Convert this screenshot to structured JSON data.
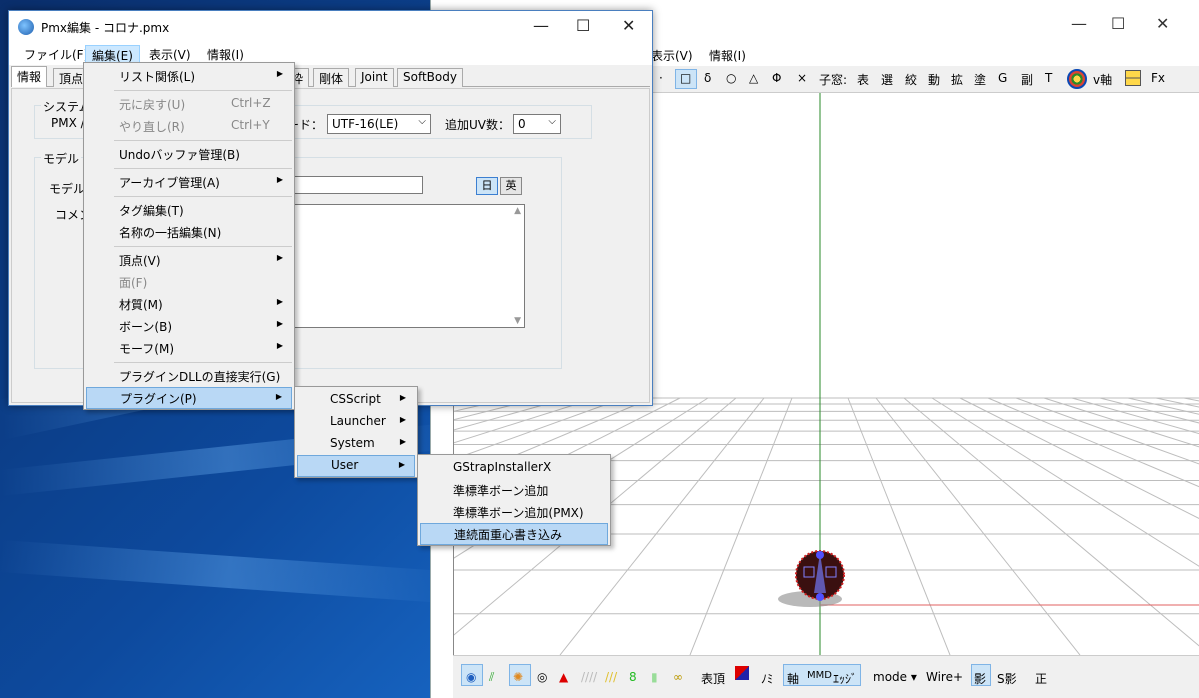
{
  "editor": {
    "title": "Pmx編集 - コロナ.pmx",
    "menu": [
      "ファイル(F)",
      "編集(E)",
      "表示(V)",
      "情報(I)"
    ],
    "tabs": [
      "情報",
      "頂点",
      "枠",
      "剛体",
      "Joint",
      "SoftBody"
    ],
    "system_group": "システム",
    "pmx_label": "PMX /",
    "encode_label": "ード：",
    "encode_value": "UTF-16(LE)",
    "uv_label": "追加UV数：",
    "uv_value": "0",
    "model_group": "モデル",
    "model_name_label": "モデル名",
    "comment_label": "コメン",
    "lang_jp": "日",
    "lang_en": "英"
  },
  "edit_menu": {
    "items": [
      {
        "label": "リスト関係(L)",
        "shortcut": "",
        "submenu": true,
        "disabled": false
      },
      {
        "label": "元に戻す(U)",
        "shortcut": "Ctrl+Z",
        "submenu": false,
        "disabled": true
      },
      {
        "label": "やり直し(R)",
        "shortcut": "Ctrl+Y",
        "submenu": false,
        "disabled": true
      },
      {
        "label": "Undoバッファ管理(B)",
        "shortcut": "",
        "submenu": false,
        "disabled": false
      },
      {
        "label": "アーカイブ管理(A)",
        "shortcut": "",
        "submenu": true,
        "disabled": false
      },
      {
        "label": "タグ編集(T)",
        "shortcut": "",
        "submenu": false,
        "disabled": false
      },
      {
        "label": "名称の一括編集(N)",
        "shortcut": "",
        "submenu": false,
        "disabled": false
      },
      {
        "label": "頂点(V)",
        "shortcut": "",
        "submenu": true,
        "disabled": false
      },
      {
        "label": "面(F)",
        "shortcut": "",
        "submenu": false,
        "disabled": true
      },
      {
        "label": "材質(M)",
        "shortcut": "",
        "submenu": true,
        "disabled": false
      },
      {
        "label": "ボーン(B)",
        "shortcut": "",
        "submenu": true,
        "disabled": false
      },
      {
        "label": "モーフ(M)",
        "shortcut": "",
        "submenu": true,
        "disabled": false
      },
      {
        "label": "プラグインDLLの直接実行(G)",
        "shortcut": "",
        "submenu": false,
        "disabled": false
      },
      {
        "label": "プラグイン(P)",
        "shortcut": "",
        "submenu": true,
        "disabled": false,
        "highlighted": true
      }
    ]
  },
  "plugin_menu": {
    "items": [
      "CSScript",
      "Launcher",
      "System",
      "User"
    ],
    "highlighted": "User"
  },
  "user_menu": {
    "items": [
      "GStrapInstallerX",
      "準標準ボーン追加",
      "準標準ボーン追加(PMX)",
      "連続面重心書き込み"
    ],
    "highlighted": "連続面重心書き込み"
  },
  "viewer": {
    "menu": [
      "表示(V)",
      "情報(I)"
    ],
    "toolbar": [
      "□",
      "δ",
      "○",
      "△",
      "Φ",
      "×",
      "子窓:",
      "表",
      "選",
      "絞",
      "動",
      "拡",
      "塗",
      "G",
      "副",
      "T",
      "v軸",
      "Fx"
    ],
    "bottom": [
      "表頂",
      "ﾉﾐ",
      "軸",
      "MMD",
      "ｴｯｼﾞ",
      "mode ▾",
      "Wire+",
      "影",
      "S影",
      "正"
    ]
  }
}
